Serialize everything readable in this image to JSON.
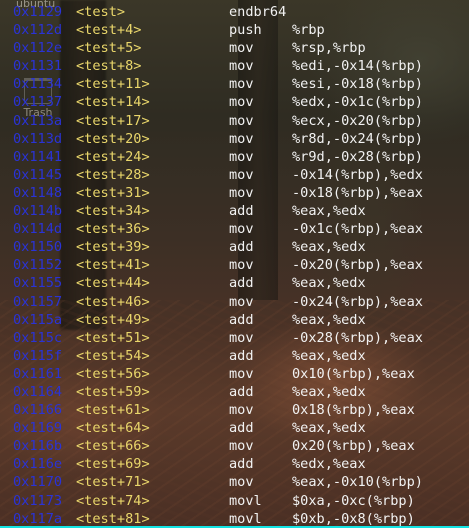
{
  "desktop": {
    "top_label": "ubuntu",
    "trash_label": "Trash"
  },
  "terminal": {
    "rows": [
      {
        "addr": "0x1129",
        "sym": "<test>",
        "mnemonic": "endbr64",
        "operands": ""
      },
      {
        "addr": "0x112d",
        "sym": "<test+4>",
        "mnemonic": "push",
        "operands": "%rbp"
      },
      {
        "addr": "0x112e",
        "sym": "<test+5>",
        "mnemonic": "mov",
        "operands": "%rsp,%rbp"
      },
      {
        "addr": "0x1131",
        "sym": "<test+8>",
        "mnemonic": "mov",
        "operands": "%edi,-0x14(%rbp)"
      },
      {
        "addr": "0x1134",
        "sym": "<test+11>",
        "mnemonic": "mov",
        "operands": "%esi,-0x18(%rbp)"
      },
      {
        "addr": "0x1137",
        "sym": "<test+14>",
        "mnemonic": "mov",
        "operands": "%edx,-0x1c(%rbp)"
      },
      {
        "addr": "0x113a",
        "sym": "<test+17>",
        "mnemonic": "mov",
        "operands": "%ecx,-0x20(%rbp)"
      },
      {
        "addr": "0x113d",
        "sym": "<test+20>",
        "mnemonic": "mov",
        "operands": "%r8d,-0x24(%rbp)"
      },
      {
        "addr": "0x1141",
        "sym": "<test+24>",
        "mnemonic": "mov",
        "operands": "%r9d,-0x28(%rbp)"
      },
      {
        "addr": "0x1145",
        "sym": "<test+28>",
        "mnemonic": "mov",
        "operands": "-0x14(%rbp),%edx"
      },
      {
        "addr": "0x1148",
        "sym": "<test+31>",
        "mnemonic": "mov",
        "operands": "-0x18(%rbp),%eax"
      },
      {
        "addr": "0x114b",
        "sym": "<test+34>",
        "mnemonic": "add",
        "operands": "%eax,%edx"
      },
      {
        "addr": "0x114d",
        "sym": "<test+36>",
        "mnemonic": "mov",
        "operands": "-0x1c(%rbp),%eax"
      },
      {
        "addr": "0x1150",
        "sym": "<test+39>",
        "mnemonic": "add",
        "operands": "%eax,%edx"
      },
      {
        "addr": "0x1152",
        "sym": "<test+41>",
        "mnemonic": "mov",
        "operands": "-0x20(%rbp),%eax"
      },
      {
        "addr": "0x1155",
        "sym": "<test+44>",
        "mnemonic": "add",
        "operands": "%eax,%edx"
      },
      {
        "addr": "0x1157",
        "sym": "<test+46>",
        "mnemonic": "mov",
        "operands": "-0x24(%rbp),%eax"
      },
      {
        "addr": "0x115a",
        "sym": "<test+49>",
        "mnemonic": "add",
        "operands": "%eax,%edx"
      },
      {
        "addr": "0x115c",
        "sym": "<test+51>",
        "mnemonic": "mov",
        "operands": "-0x28(%rbp),%eax"
      },
      {
        "addr": "0x115f",
        "sym": "<test+54>",
        "mnemonic": "add",
        "operands": "%eax,%edx"
      },
      {
        "addr": "0x1161",
        "sym": "<test+56>",
        "mnemonic": "mov",
        "operands": "0x10(%rbp),%eax"
      },
      {
        "addr": "0x1164",
        "sym": "<test+59>",
        "mnemonic": "add",
        "operands": "%eax,%edx"
      },
      {
        "addr": "0x1166",
        "sym": "<test+61>",
        "mnemonic": "mov",
        "operands": "0x18(%rbp),%eax"
      },
      {
        "addr": "0x1169",
        "sym": "<test+64>",
        "mnemonic": "add",
        "operands": "%eax,%edx"
      },
      {
        "addr": "0x116b",
        "sym": "<test+66>",
        "mnemonic": "mov",
        "operands": "0x20(%rbp),%eax"
      },
      {
        "addr": "0x116e",
        "sym": "<test+69>",
        "mnemonic": "add",
        "operands": "%edx,%eax"
      },
      {
        "addr": "0x1170",
        "sym": "<test+71>",
        "mnemonic": "mov",
        "operands": "%eax,-0x10(%rbp)"
      },
      {
        "addr": "0x1173",
        "sym": "<test+74>",
        "mnemonic": "movl",
        "operands": "$0xa,-0xc(%rbp)"
      },
      {
        "addr": "0x117a",
        "sym": "<test+81>",
        "mnemonic": "movl",
        "operands": "$0xb,-0x8(%rbp)"
      }
    ]
  },
  "colors": {
    "address": "#2a33d6",
    "symbol": "#e9d66b",
    "instruction": "#f2f2f2",
    "status_line": "#14e4e4"
  }
}
